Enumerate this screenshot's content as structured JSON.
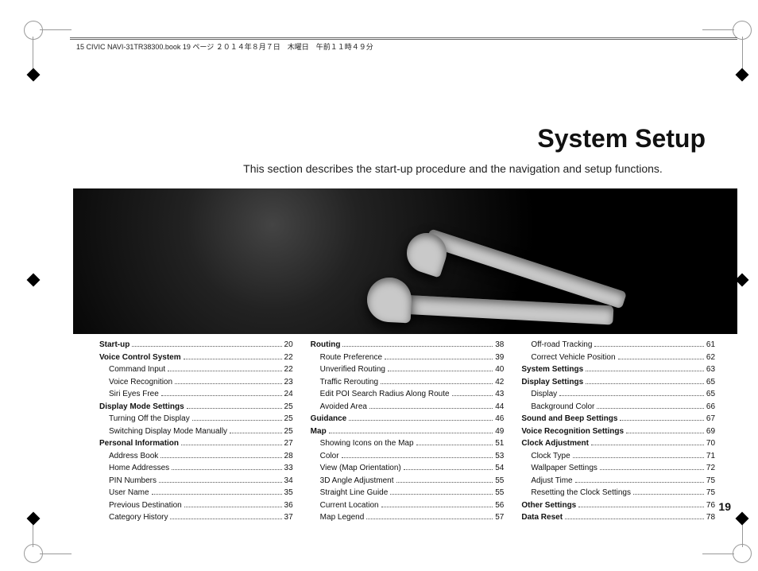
{
  "meta": "15 CIVIC NAVI-31TR38300.book   19 ページ   ２０１４年８月７日　木曜日　午前１１時４９分",
  "title": "System Setup",
  "subtitle": "This section describes the start-up procedure and the navigation and setup functions.",
  "page_number": "19",
  "toc": {
    "col1": [
      {
        "label": "Start-up",
        "pg": "20",
        "bold": true,
        "indent": false
      },
      {
        "label": "Voice Control System",
        "pg": "22",
        "bold": true,
        "indent": false
      },
      {
        "label": "Command Input",
        "pg": "22",
        "bold": false,
        "indent": true
      },
      {
        "label": "Voice Recognition",
        "pg": "23",
        "bold": false,
        "indent": true
      },
      {
        "label": "Siri Eyes Free",
        "pg": "24",
        "bold": false,
        "indent": true
      },
      {
        "label": "Display Mode Settings",
        "pg": "25",
        "bold": true,
        "indent": false
      },
      {
        "label": "Turning Off the Display",
        "pg": "25",
        "bold": false,
        "indent": true
      },
      {
        "label": "Switching Display Mode Manually",
        "pg": "25",
        "bold": false,
        "indent": true
      },
      {
        "label": "Personal Information",
        "pg": "27",
        "bold": true,
        "indent": false
      },
      {
        "label": "Address Book",
        "pg": "28",
        "bold": false,
        "indent": true
      },
      {
        "label": "Home Addresses",
        "pg": "33",
        "bold": false,
        "indent": true
      },
      {
        "label": "PIN Numbers",
        "pg": "34",
        "bold": false,
        "indent": true
      },
      {
        "label": "User Name",
        "pg": "35",
        "bold": false,
        "indent": true
      },
      {
        "label": "Previous Destination",
        "pg": "36",
        "bold": false,
        "indent": true
      },
      {
        "label": "Category History",
        "pg": "37",
        "bold": false,
        "indent": true
      }
    ],
    "col2": [
      {
        "label": "Routing",
        "pg": "38",
        "bold": true,
        "indent": false
      },
      {
        "label": "Route Preference",
        "pg": "39",
        "bold": false,
        "indent": true
      },
      {
        "label": "Unverified Routing",
        "pg": "40",
        "bold": false,
        "indent": true
      },
      {
        "label": "Traffic Rerouting",
        "pg": "42",
        "bold": false,
        "indent": true
      },
      {
        "label": "Edit POI Search Radius Along Route",
        "pg": "43",
        "bold": false,
        "indent": true
      },
      {
        "label": "Avoided Area",
        "pg": "44",
        "bold": false,
        "indent": true
      },
      {
        "label": "Guidance",
        "pg": "46",
        "bold": true,
        "indent": false
      },
      {
        "label": "Map",
        "pg": "49",
        "bold": true,
        "indent": false
      },
      {
        "label": "Showing Icons on the Map",
        "pg": "51",
        "bold": false,
        "indent": true
      },
      {
        "label": "Color",
        "pg": "53",
        "bold": false,
        "indent": true
      },
      {
        "label": "View (Map Orientation)",
        "pg": "54",
        "bold": false,
        "indent": true
      },
      {
        "label": "3D Angle Adjustment",
        "pg": "55",
        "bold": false,
        "indent": true
      },
      {
        "label": "Straight Line Guide",
        "pg": "55",
        "bold": false,
        "indent": true
      },
      {
        "label": "Current Location",
        "pg": "56",
        "bold": false,
        "indent": true
      },
      {
        "label": "Map Legend",
        "pg": "57",
        "bold": false,
        "indent": true
      }
    ],
    "col3": [
      {
        "label": "Off-road Tracking",
        "pg": "61",
        "bold": false,
        "indent": true
      },
      {
        "label": "Correct Vehicle Position",
        "pg": "62",
        "bold": false,
        "indent": true
      },
      {
        "label": "System Settings",
        "pg": "63",
        "bold": true,
        "indent": false
      },
      {
        "label": "Display Settings",
        "pg": "65",
        "bold": true,
        "indent": false
      },
      {
        "label": "Display",
        "pg": "65",
        "bold": false,
        "indent": true
      },
      {
        "label": "Background Color",
        "pg": "66",
        "bold": false,
        "indent": true
      },
      {
        "label": "Sound and Beep Settings",
        "pg": "67",
        "bold": true,
        "indent": false
      },
      {
        "label": "Voice Recognition Settings",
        "pg": "69",
        "bold": true,
        "indent": false
      },
      {
        "label": "Clock Adjustment",
        "pg": "70",
        "bold": true,
        "indent": false
      },
      {
        "label": "Clock Type",
        "pg": "71",
        "bold": false,
        "indent": true
      },
      {
        "label": "Wallpaper Settings",
        "pg": "72",
        "bold": false,
        "indent": true
      },
      {
        "label": "Adjust Time",
        "pg": "75",
        "bold": false,
        "indent": true
      },
      {
        "label": "Resetting the Clock Settings",
        "pg": "75",
        "bold": false,
        "indent": true
      },
      {
        "label": "Other Settings",
        "pg": "76",
        "bold": true,
        "indent": false
      },
      {
        "label": "Data Reset",
        "pg": "78",
        "bold": true,
        "indent": false
      }
    ]
  }
}
